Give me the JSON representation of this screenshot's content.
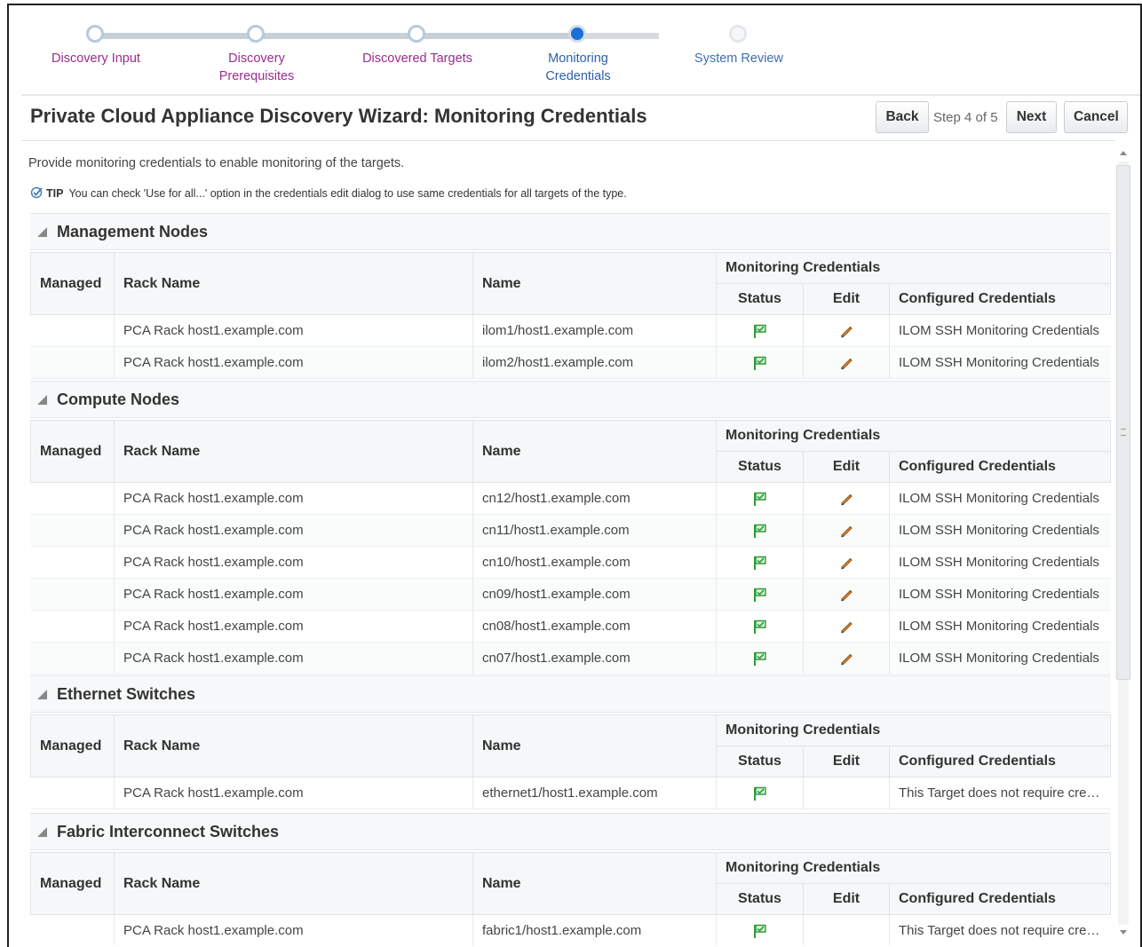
{
  "train": {
    "steps": [
      {
        "label": "Discovery Input",
        "state": "visited"
      },
      {
        "label": "Discovery Prerequisites",
        "state": "visited"
      },
      {
        "label": "Discovered Targets",
        "state": "visited"
      },
      {
        "label": "Monitoring Credentials",
        "state": "current"
      },
      {
        "label": "System Review",
        "state": "future"
      }
    ]
  },
  "header": {
    "title": "Private Cloud Appliance Discovery Wizard: Monitoring Credentials",
    "back_label": "Back",
    "step_text": "Step 4 of 5",
    "next_label": "Next",
    "cancel_label": "Cancel"
  },
  "intro": "Provide monitoring credentials to enable monitoring of the targets.",
  "tip": {
    "label": "TIP",
    "text": "You can check 'Use for all...' option in the credentials edit dialog to use same credentials for all targets of the type."
  },
  "columns": {
    "managed": "Managed",
    "rack_name": "Rack Name",
    "name": "Name",
    "monitoring_credentials": "Monitoring Credentials",
    "status": "Status",
    "edit": "Edit",
    "configured_credentials": "Configured Credentials"
  },
  "sections": {
    "management": {
      "title": "Management Nodes",
      "rows": [
        {
          "rack": "PCA Rack host1.example.com",
          "name": "ilom1/host1.example.com",
          "cred": "ILOM SSH Monitoring Credentials"
        },
        {
          "rack": "PCA Rack host1.example.com",
          "name": "ilom2/host1.example.com",
          "cred": "ILOM SSH Monitoring Credentials"
        }
      ]
    },
    "compute": {
      "title": "Compute Nodes",
      "rows": [
        {
          "rack": "PCA Rack host1.example.com",
          "name": "cn12/host1.example.com",
          "cred": "ILOM SSH Monitoring Credentials"
        },
        {
          "rack": "PCA Rack host1.example.com",
          "name": "cn11/host1.example.com",
          "cred": "ILOM SSH Monitoring Credentials"
        },
        {
          "rack": "PCA Rack host1.example.com",
          "name": "cn10/host1.example.com",
          "cred": "ILOM SSH Monitoring Credentials"
        },
        {
          "rack": "PCA Rack host1.example.com",
          "name": "cn09/host1.example.com",
          "cred": "ILOM SSH Monitoring Credentials"
        },
        {
          "rack": "PCA Rack host1.example.com",
          "name": "cn08/host1.example.com",
          "cred": "ILOM SSH Monitoring Credentials"
        },
        {
          "rack": "PCA Rack host1.example.com",
          "name": "cn07/host1.example.com",
          "cred": "ILOM SSH Monitoring Credentials"
        }
      ]
    },
    "ethernet": {
      "title": "Ethernet Switches",
      "rows": [
        {
          "rack": "PCA Rack host1.example.com",
          "name": "ethernet1/host1.example.com",
          "cred": "This Target does not require credentials"
        }
      ]
    },
    "fabric": {
      "title": "Fabric Interconnect Switches",
      "rows": [
        {
          "rack": "PCA Rack host1.example.com",
          "name": "fabric1/host1.example.com",
          "cred": "This Target does not require credentials"
        }
      ]
    }
  },
  "colors": {
    "visited_link": "#9b2c8c",
    "current_step": "#1b6fd6",
    "flag_green": "#2e9b3a",
    "pencil_orange": "#d9822b"
  },
  "icons": {
    "status": "green-flag-icon",
    "edit": "pencil-icon",
    "tip": "checkmark-icon"
  }
}
